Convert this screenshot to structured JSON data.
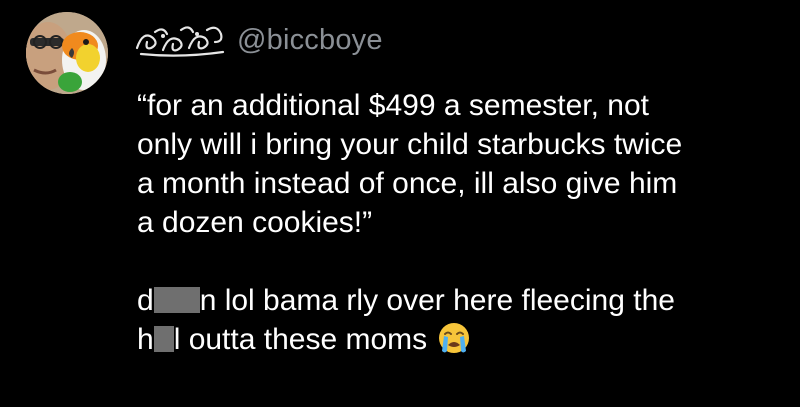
{
  "post": {
    "handle": "@biccboye",
    "quote_lines": [
      "“for an additional $499 a semester, not",
      "only will i bring your child starbucks twice",
      "a month instead of once, ill also give him",
      "a dozen cookies!”"
    ],
    "comment": {
      "line1_start": "d",
      "line1_end": "n lol bama rly over here fleecing the",
      "line2_start": "h",
      "line2_end": "l outta these moms"
    },
    "emoji": "loudly-crying-face-icon"
  },
  "colors": {
    "background": "#000000",
    "text": "#ffffff",
    "handle": "#8b9096",
    "redaction": "#6f6f6f"
  }
}
